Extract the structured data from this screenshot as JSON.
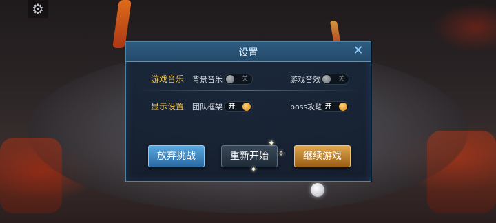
{
  "hud": {
    "settings_icon": "gear-icon",
    "joystick_icon": "joystick-knob-icon"
  },
  "dialog": {
    "title": "设置",
    "close_icon": "close-icon",
    "rows": [
      {
        "label": "游戏音乐",
        "options": [
          {
            "label": "背景音乐",
            "state": "关",
            "on": false
          },
          {
            "label": "游戏音效",
            "state": "关",
            "on": false
          }
        ]
      },
      {
        "label": "显示设置",
        "options": [
          {
            "label": "团队框架",
            "state": "开",
            "on": true
          },
          {
            "label": "boss攻略",
            "state": "开",
            "on": true
          }
        ]
      }
    ],
    "buttons": {
      "abandon": "放弃挑战",
      "restart": "重新开始",
      "continue": "继续游戏"
    }
  },
  "colors": {
    "accent_blue": "#8fd0ff",
    "label_gold": "#f0c54a",
    "toggle_on": "#d7860f",
    "button_continue": "#e0a64a"
  }
}
